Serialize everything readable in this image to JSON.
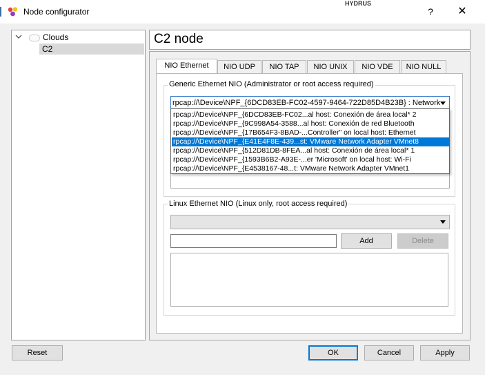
{
  "window": {
    "title": "Node configurator",
    "help_label": "?",
    "close_label": "✕",
    "background_text": "HYDRUS"
  },
  "tree": {
    "items": [
      {
        "label": "Clouds",
        "expanded": true,
        "icon": "cloud-icon"
      },
      {
        "label": "C2",
        "selected": true
      }
    ]
  },
  "node": {
    "title": "C2 node"
  },
  "tabs": [
    {
      "label": "NIO Ethernet",
      "active": true
    },
    {
      "label": "NIO UDP"
    },
    {
      "label": "NIO TAP"
    },
    {
      "label": "NIO UNIX"
    },
    {
      "label": "NIO VDE"
    },
    {
      "label": "NIO NULL"
    }
  ],
  "generic": {
    "title": "Generic Ethernet NIO (Administrator or root access required)",
    "selected": "rpcap://\\Device\\NPF_{6DCD83EB-FC02-4597-9464-722D85D4B23B} : Network",
    "options": [
      "rpcap://\\Device\\NPF_{6DCD83EB-FC02...al host: Conexión de área local* 2",
      "rpcap://\\Device\\NPF_{9C998A54-3588...al host: Conexión de red Bluetooth",
      "rpcap://\\Device\\NPF_{17B654F3-8BAD-...Controller\" on local host: Ethernet",
      "rpcap://\\Device\\NPF_{E41E4F8E-439...st: VMware Network Adapter VMnet8",
      "rpcap://\\Device\\NPF_{512D81DB-8FEA...al host: Conexión de área local* 1",
      "rpcap://\\Device\\NPF_{1593B6B2-A93E-...er 'Microsoft' on local host: Wi-Fi",
      "rpcap://\\Device\\NPF_{E4538167-48...t: VMware Network Adapter VMnet1"
    ],
    "highlighted_index": 3
  },
  "linux": {
    "title": "Linux Ethernet NIO (Linux only, root access required)",
    "selected": "",
    "input_value": "",
    "add_label": "Add",
    "delete_label": "Delete"
  },
  "footer": {
    "reset_label": "Reset",
    "ok_label": "OK",
    "cancel_label": "Cancel",
    "apply_label": "Apply"
  },
  "colors": {
    "selection": "#0078d7",
    "focus_border": "#3377cc"
  }
}
